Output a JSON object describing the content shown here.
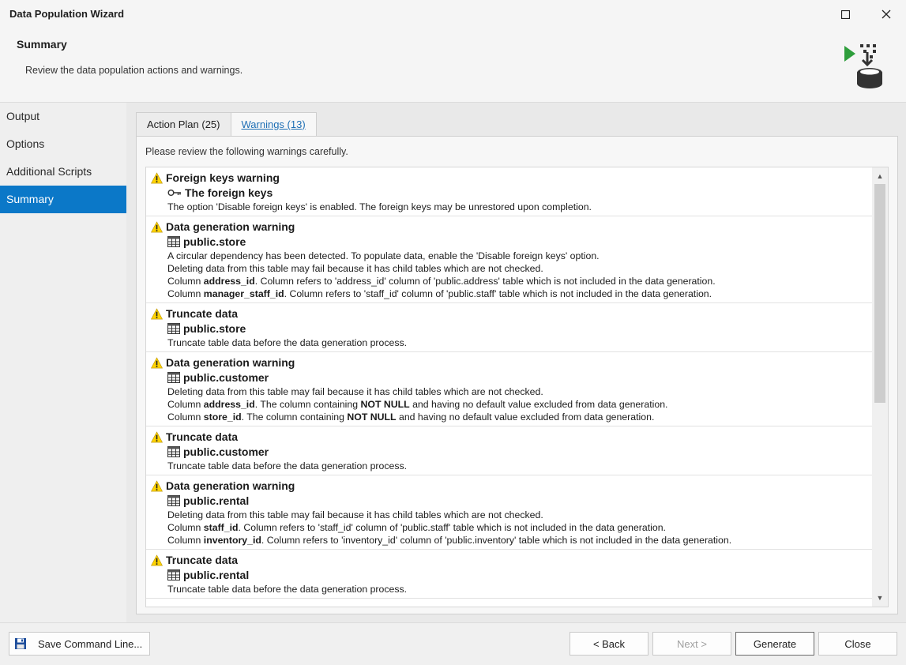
{
  "window": {
    "title": "Data Population Wizard"
  },
  "header": {
    "title": "Summary",
    "subtitle": "Review the data population actions and warnings."
  },
  "sidebar": {
    "items": [
      {
        "label": "Output",
        "active": false
      },
      {
        "label": "Options",
        "active": false
      },
      {
        "label": "Additional Scripts",
        "active": false
      },
      {
        "label": "Summary",
        "active": true
      }
    ]
  },
  "tabs": [
    {
      "label": "Action Plan (25)",
      "active": false
    },
    {
      "label": "Warnings (13)",
      "active": true
    }
  ],
  "panel": {
    "caption": "Please review the following warnings carefully."
  },
  "warnings": [
    {
      "title": "Foreign keys warning",
      "object_icon": "key-icon",
      "object": "The foreign keys",
      "lines": [
        [
          [
            "t",
            "The option 'Disable foreign keys' is enabled. The foreign keys may be unrestored upon completion."
          ]
        ]
      ]
    },
    {
      "title": "Data generation warning",
      "object_icon": "table-icon",
      "object": "public.store",
      "lines": [
        [
          [
            "t",
            "A circular dependency has been detected. To populate data, enable the 'Disable foreign keys' option."
          ]
        ],
        [
          [
            "t",
            "Deleting data from this table may fail because it has child tables which are not checked."
          ]
        ],
        [
          [
            "t",
            "Column "
          ],
          [
            "b",
            "address_id"
          ],
          [
            "t",
            ". Column refers to 'address_id' column of 'public.address' table which is not included in the data generation."
          ]
        ],
        [
          [
            "t",
            "Column "
          ],
          [
            "b",
            "manager_staff_id"
          ],
          [
            "t",
            ". Column refers to 'staff_id' column of 'public.staff' table which is not included in the data generation."
          ]
        ]
      ]
    },
    {
      "title": "Truncate data",
      "object_icon": "table-icon",
      "object": "public.store",
      "lines": [
        [
          [
            "t",
            "Truncate table data before the data generation process."
          ]
        ]
      ]
    },
    {
      "title": "Data generation warning",
      "object_icon": "table-icon",
      "object": "public.customer",
      "lines": [
        [
          [
            "t",
            "Deleting data from this table may fail because it has child tables which are not checked."
          ]
        ],
        [
          [
            "t",
            "Column "
          ],
          [
            "b",
            "address_id"
          ],
          [
            "t",
            ". The column containing "
          ],
          [
            "b",
            "NOT NULL"
          ],
          [
            "t",
            " and having no default value excluded from data generation."
          ]
        ],
        [
          [
            "t",
            "Column "
          ],
          [
            "b",
            "store_id"
          ],
          [
            "t",
            ". The column containing "
          ],
          [
            "b",
            "NOT NULL"
          ],
          [
            "t",
            " and having no default value excluded from data generation."
          ]
        ]
      ]
    },
    {
      "title": "Truncate data",
      "object_icon": "table-icon",
      "object": "public.customer",
      "lines": [
        [
          [
            "t",
            "Truncate table data before the data generation process."
          ]
        ]
      ]
    },
    {
      "title": "Data generation warning",
      "object_icon": "table-icon",
      "object": "public.rental",
      "lines": [
        [
          [
            "t",
            "Deleting data from this table may fail because it has child tables which are not checked."
          ]
        ],
        [
          [
            "t",
            "Column "
          ],
          [
            "b",
            "staff_id"
          ],
          [
            "t",
            ". Column refers to 'staff_id' column of 'public.staff' table which is not included in the data generation."
          ]
        ],
        [
          [
            "t",
            "Column "
          ],
          [
            "b",
            "inventory_id"
          ],
          [
            "t",
            ". Column refers to 'inventory_id' column of 'public.inventory' table which is not included in the data generation."
          ]
        ]
      ]
    },
    {
      "title": "Truncate data",
      "object_icon": "table-icon",
      "object": "public.rental",
      "lines": [
        [
          [
            "t",
            "Truncate table data before the data generation process."
          ]
        ]
      ]
    }
  ],
  "footer": {
    "save_label": "Save Command Line...",
    "back_label": "< Back",
    "next_label": "Next >",
    "generate_label": "Generate",
    "close_label": "Close"
  },
  "colors": {
    "accent": "#0b78c8",
    "warning_fill": "#ffd400",
    "icon_green": "#2e9e3c"
  }
}
